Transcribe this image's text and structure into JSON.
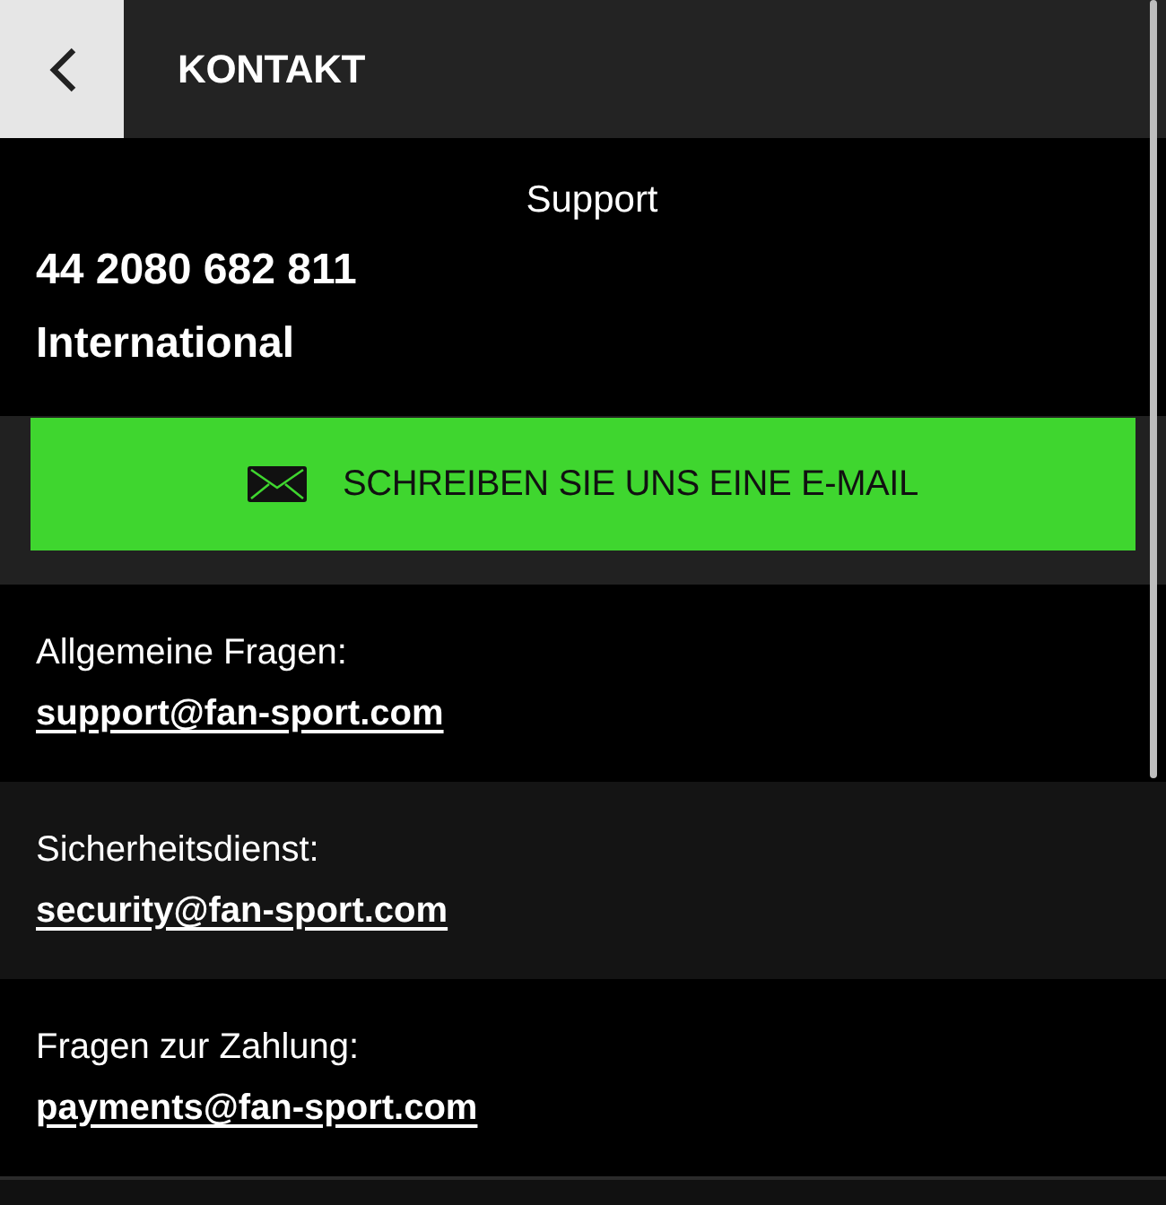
{
  "header": {
    "title": "KONTAKT"
  },
  "support": {
    "title": "Support",
    "phone": "44 2080 682 811",
    "region": "International"
  },
  "email_button": {
    "label": "SCHREIBEN SIE UNS EINE E-MAIL"
  },
  "contacts": [
    {
      "label": "Allgemeine Fragen:",
      "email": "support@fan-sport.com"
    },
    {
      "label": "Sicherheitsdienst:",
      "email": "security@fan-sport.com"
    },
    {
      "label": "Fragen zur Zahlung:",
      "email": "payments@fan-sport.com"
    }
  ]
}
